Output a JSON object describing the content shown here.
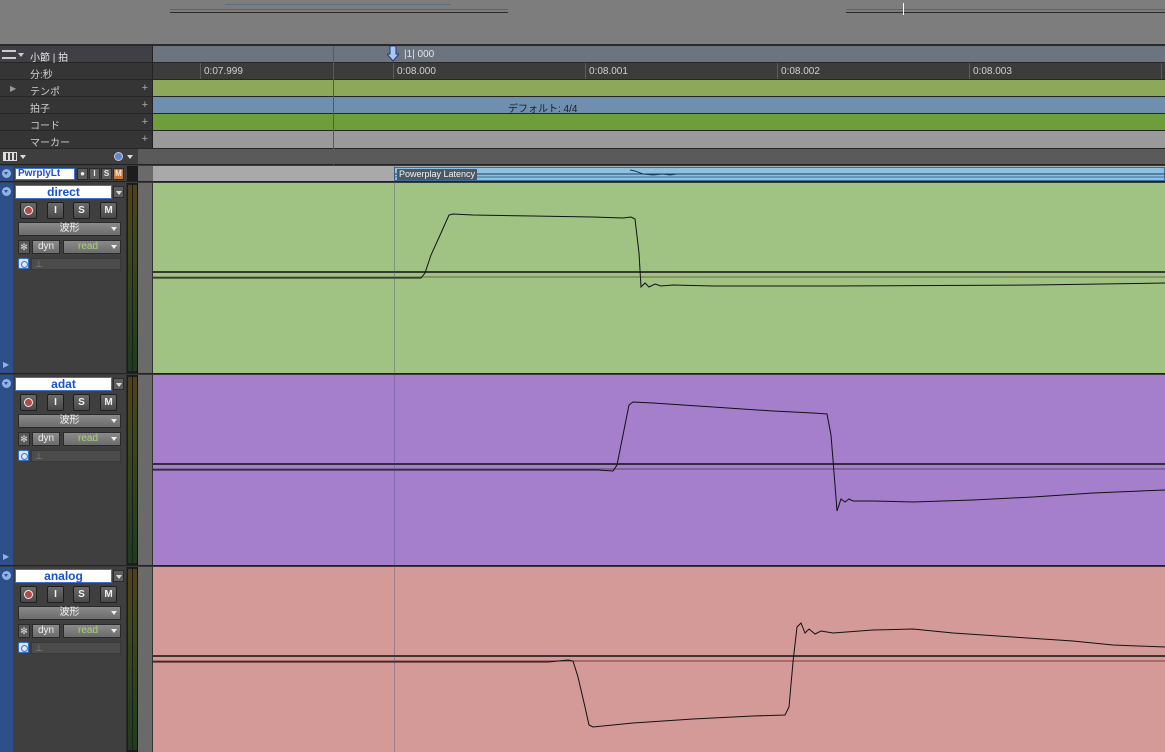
{
  "colors": {
    "tempo": "#8ea85a",
    "meter": "#6f8fb1",
    "chord": "#6e9e3c",
    "marker": "#9a9a9a",
    "playhead": "#e0201a",
    "track_direct": "#a0c283",
    "track_adat": "#a57fcb",
    "track_analog": "#d39a98",
    "track_name_text": "#1a4fd8"
  },
  "rulers": {
    "bars_beats": {
      "label": "小節 | 拍",
      "edit_position": "|1| 000"
    },
    "min_sec": {
      "label": "分:秒",
      "ticks": [
        "0:07.999",
        "0:08.000",
        "0:08.001",
        "0:08.002",
        "0:08.003"
      ]
    },
    "tempo": {
      "label": "テンポ",
      "add": "+"
    },
    "meter": {
      "label": "拍子",
      "add": "+",
      "value": "デフォルト: 4/4"
    },
    "chord": {
      "label": "コード",
      "add": "+"
    },
    "marker": {
      "label": "マーカー",
      "add": "+"
    }
  },
  "aux_track": {
    "name": "PwrplyLt",
    "buttons": {
      "rec": "●",
      "input": "I",
      "solo": "S",
      "mute": "M"
    },
    "clip_label": "Powerplay Latency"
  },
  "tracks": [
    {
      "name": "direct",
      "buttons": {
        "input": "I",
        "solo": "S",
        "mute": "M"
      },
      "view": "波形",
      "dyn": "dyn",
      "automation": "read",
      "input_symbol": "⊥"
    },
    {
      "name": "adat",
      "buttons": {
        "input": "I",
        "solo": "S",
        "mute": "M"
      },
      "view": "波形",
      "dyn": "dyn",
      "automation": "read",
      "input_symbol": "⊥"
    },
    {
      "name": "analog",
      "buttons": {
        "input": "I",
        "solo": "S",
        "mute": "M"
      },
      "view": "波形",
      "dyn": "dyn",
      "automation": "read",
      "input_symbol": "⊥"
    }
  ]
}
